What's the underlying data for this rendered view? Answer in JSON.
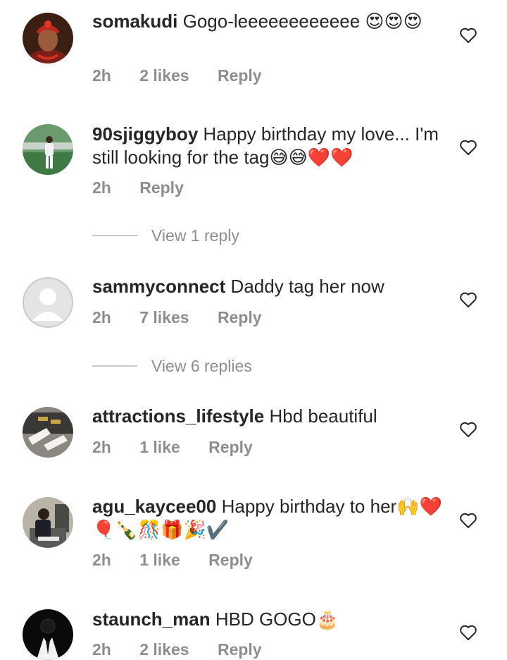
{
  "comments": [
    {
      "username": "somakudi",
      "text": "Gogo-leeeeeeeeeeee",
      "emojis": "😍😍😍",
      "time": "2h",
      "likes": "2 likes",
      "reply": "Reply"
    },
    {
      "username": "90sjiggyboy",
      "text": "Happy birthday my love... I'm still looking for the tag",
      "emojis": "😅😅❤️❤️",
      "time": "2h",
      "likes": "",
      "reply": "Reply",
      "view_replies": "View 1 reply"
    },
    {
      "username": "sammyconnect",
      "text": "Daddy tag her now",
      "emojis": "",
      "time": "2h",
      "likes": "7 likes",
      "reply": "Reply",
      "view_replies": "View 6 replies"
    },
    {
      "username": "attractions_lifestyle",
      "text": "Hbd beautiful",
      "emojis": "",
      "time": "2h",
      "likes": "1 like",
      "reply": "Reply"
    },
    {
      "username": "agu_kaycee00",
      "text": "Happy birthday to her",
      "emojis": "🙌❤️🎈🍾🎊🎁🎉✔️",
      "time": "2h",
      "likes": "1 like",
      "reply": "Reply"
    },
    {
      "username": "staunch_man",
      "text": "HBD GOGO",
      "emojis": "🎂",
      "time": "2h",
      "likes": "2 likes",
      "reply": "Reply"
    }
  ],
  "icons": {
    "like": "heart-outline-icon"
  },
  "colors": {
    "text": "#262626",
    "meta": "#8e8e8e",
    "divider": "#c7c7c7"
  }
}
